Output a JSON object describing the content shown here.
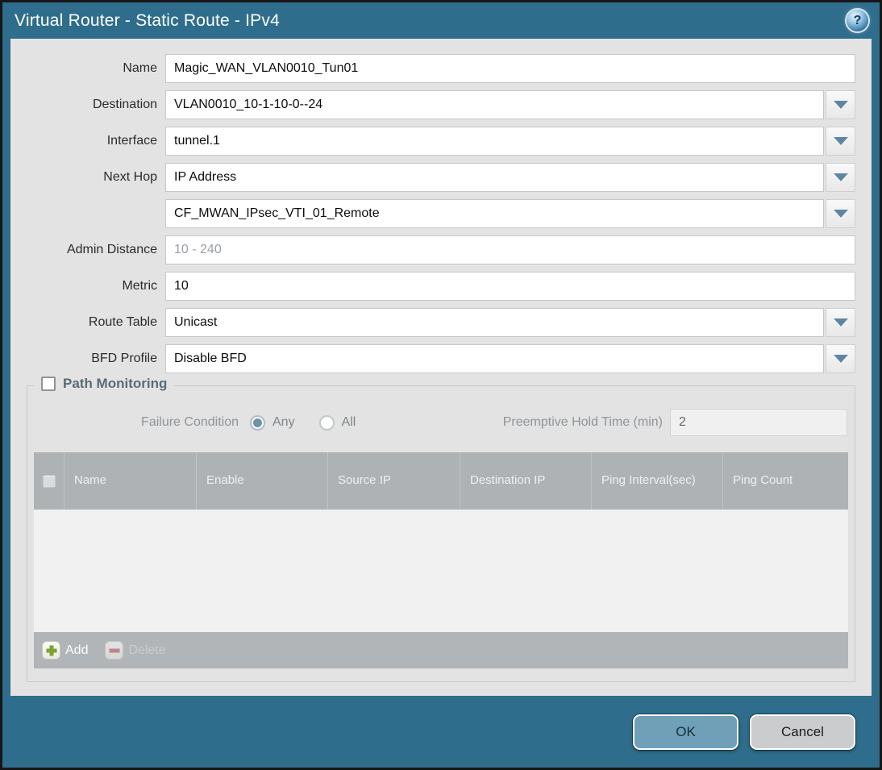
{
  "colors": {
    "frame": "#2e6d8c",
    "content_bg": "#e3e3e3",
    "table_header_bg": "#aeb2b4",
    "ok_button": "#6fa0b7",
    "cancel_button": "#caccce"
  },
  "titlebar": {
    "title": "Virtual Router - Static Route - IPv4",
    "help_icon": "question-mark-circle"
  },
  "form": {
    "name": {
      "label": "Name",
      "value": "Magic_WAN_VLAN0010_Tun01"
    },
    "destination": {
      "label": "Destination",
      "value": "VLAN0010_10-1-10-0--24"
    },
    "interface": {
      "label": "Interface",
      "value": "tunnel.1"
    },
    "next_hop": {
      "label": "Next Hop",
      "value": "IP Address"
    },
    "next_hop_address": {
      "value": "CF_MWAN_IPsec_VTI_01_Remote"
    },
    "admin_distance": {
      "label": "Admin Distance",
      "placeholder": "10 - 240",
      "value": ""
    },
    "metric": {
      "label": "Metric",
      "value": "10"
    },
    "route_table": {
      "label": "Route Table",
      "value": "Unicast"
    },
    "bfd_profile": {
      "label": "BFD Profile",
      "value": "Disable BFD"
    }
  },
  "path_monitoring": {
    "title": "Path Monitoring",
    "enabled": false,
    "failure_condition": {
      "label": "Failure Condition",
      "options": [
        {
          "label": "Any",
          "selected": true
        },
        {
          "label": "All",
          "selected": false
        }
      ]
    },
    "preemptive_hold_time": {
      "label": "Preemptive Hold Time (min)",
      "value": "2"
    },
    "table": {
      "headers": [
        "Name",
        "Enable",
        "Source IP",
        "Destination IP",
        "Ping Interval(sec)",
        "Ping Count"
      ],
      "rows": []
    },
    "toolbar": {
      "add_label": "Add",
      "delete_label": "Delete"
    }
  },
  "footer": {
    "ok_label": "OK",
    "cancel_label": "Cancel"
  }
}
